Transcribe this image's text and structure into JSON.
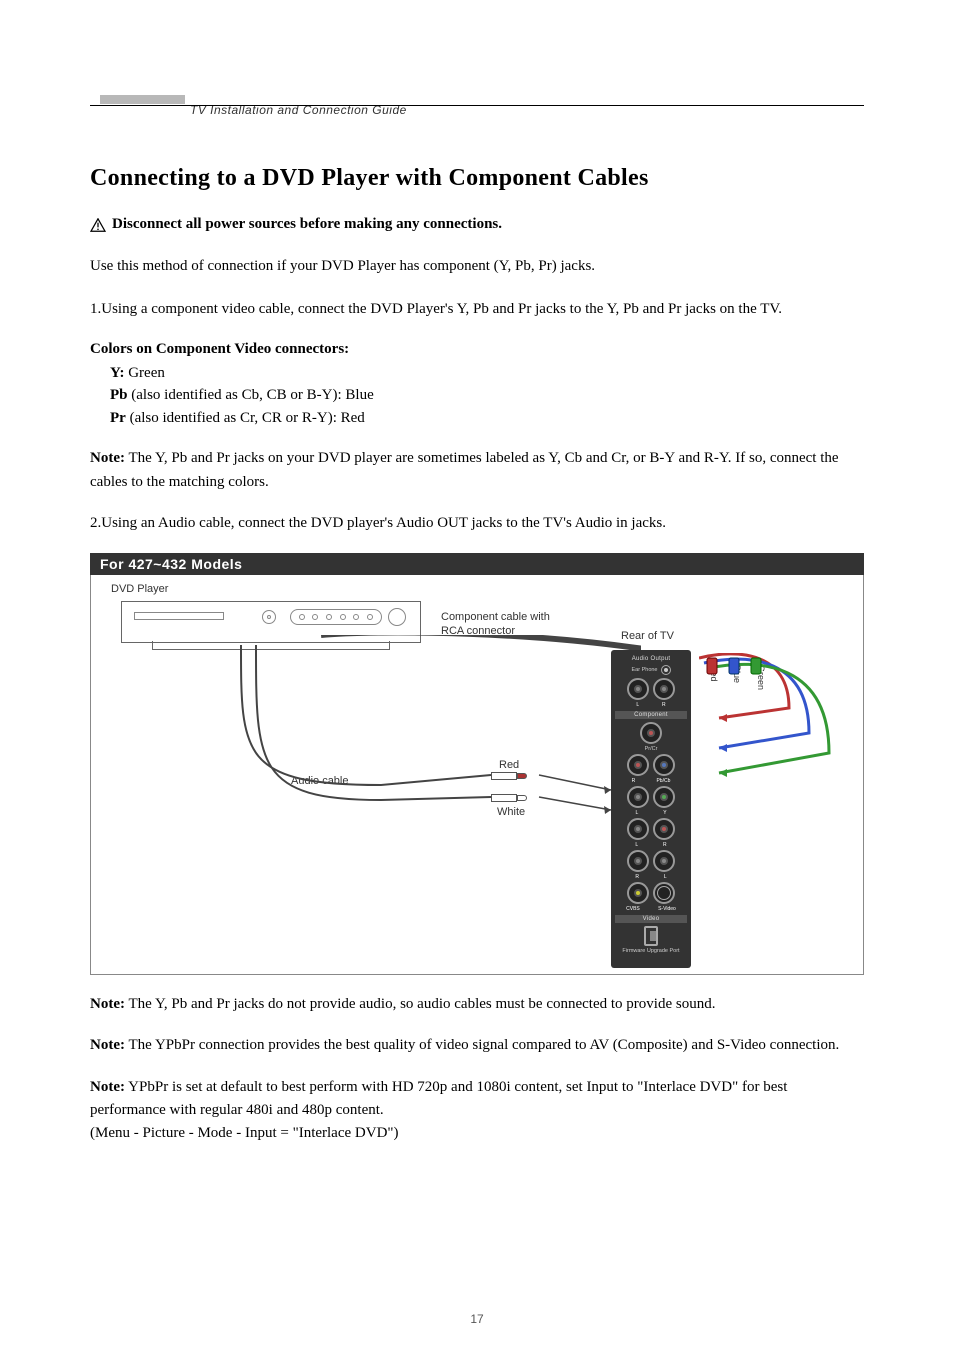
{
  "header_section": "TV Installation and Connection Guide",
  "title": "Connecting to a DVD Player with Component Cables",
  "warning": "Disconnect all power sources before making any connections.",
  "intro": "Use this method of connection if your DVD Player has component (Y, Pb, Pr) jacks.",
  "step1": "1.Using a component video cable, connect the DVD Player's Y, Pb and Pr jacks to the Y, Pb and Pr jacks on the TV.",
  "colors": {
    "heading": "Colors on Component Video connectors:",
    "y_label": "Y:",
    "y_text": " Green",
    "pb_label": "Pb",
    "pb_text": " (also identified as Cb, CB or B-Y): Blue",
    "pr_label": "Pr",
    "pr_text": " (also identified as Cr, CR or R-Y): Red"
  },
  "note1_label": "Note:",
  "note1_text": " The Y, Pb and Pr jacks on your DVD player are sometimes labeled as Y, Cb and Cr, or B-Y and R-Y. If so, connect the cables to the matching colors.",
  "step2": "2.Using an Audio cable, connect the DVD player's Audio OUT jacks to the TV's Audio in jacks.",
  "diagram": {
    "title": "For 427~432 Models",
    "dvd_label": "DVD Player",
    "component_cable": "Component cable with RCA connector",
    "rear_tv": "Rear of TV",
    "audio_cable": "Audio cable",
    "red": "Red",
    "white": "White",
    "blue": "Blue",
    "green": "Green",
    "panel": {
      "audio_output": "Audio Output",
      "ear_phone": "Ear Phone",
      "component": "Component",
      "prcr": "Pr/Cr",
      "pbcb": "Pb/Cb",
      "y": "Y",
      "r": "R",
      "l": "L",
      "cvbs": "CVBS",
      "svideo": "S-Video",
      "video": "Video",
      "firmware": "Firmware Upgrade Port"
    }
  },
  "note2_label": "Note:",
  "note2_text": " The Y, Pb and Pr jacks do not provide audio, so audio cables must be connected to provide sound.",
  "note3_label": "Note:",
  "note3_text": " The YPbPr connection provides the best quality of video signal compared to AV (Composite) and S-Video connection.",
  "note4_label": "Note:",
  "note4_text": " YPbPr is set at default to best perform with HD 720p and 1080i content, set Input to \"Interlace DVD\" for best performance with regular 480i and 480p content.",
  "note4_extra": "(Menu - Picture - Mode - Input = \"Interlace DVD\")",
  "page_number": "17"
}
